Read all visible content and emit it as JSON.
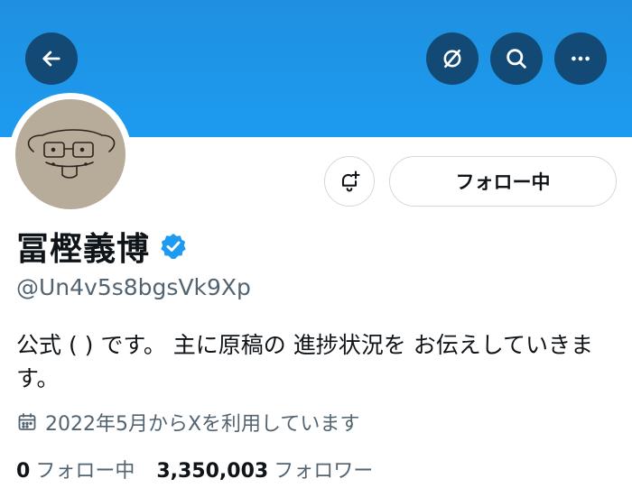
{
  "header": {
    "back_icon": "arrow-left-icon",
    "grok_icon": "grok-icon",
    "search_icon": "search-icon",
    "more_icon": "more-horizontal-icon"
  },
  "colors": {
    "banner": "#1d9bf0",
    "header_button": "#124a75",
    "verified": "#1d9bf0"
  },
  "profile": {
    "name": "冨樫義博",
    "handle": "@Un4v5s8bgsVk9Xp",
    "bio": "公式 ( ) です。 主に原稿の 進捗状況を お伝えしていきます。",
    "joined": "2022年5月からXを利用しています"
  },
  "actions": {
    "notify_icon": "bell-plus-icon",
    "following_label": "フォロー中"
  },
  "stats": {
    "following_count": "0",
    "following_label": "フォロー中",
    "followers_count": "3,350,003",
    "followers_label": "フォロワー"
  }
}
